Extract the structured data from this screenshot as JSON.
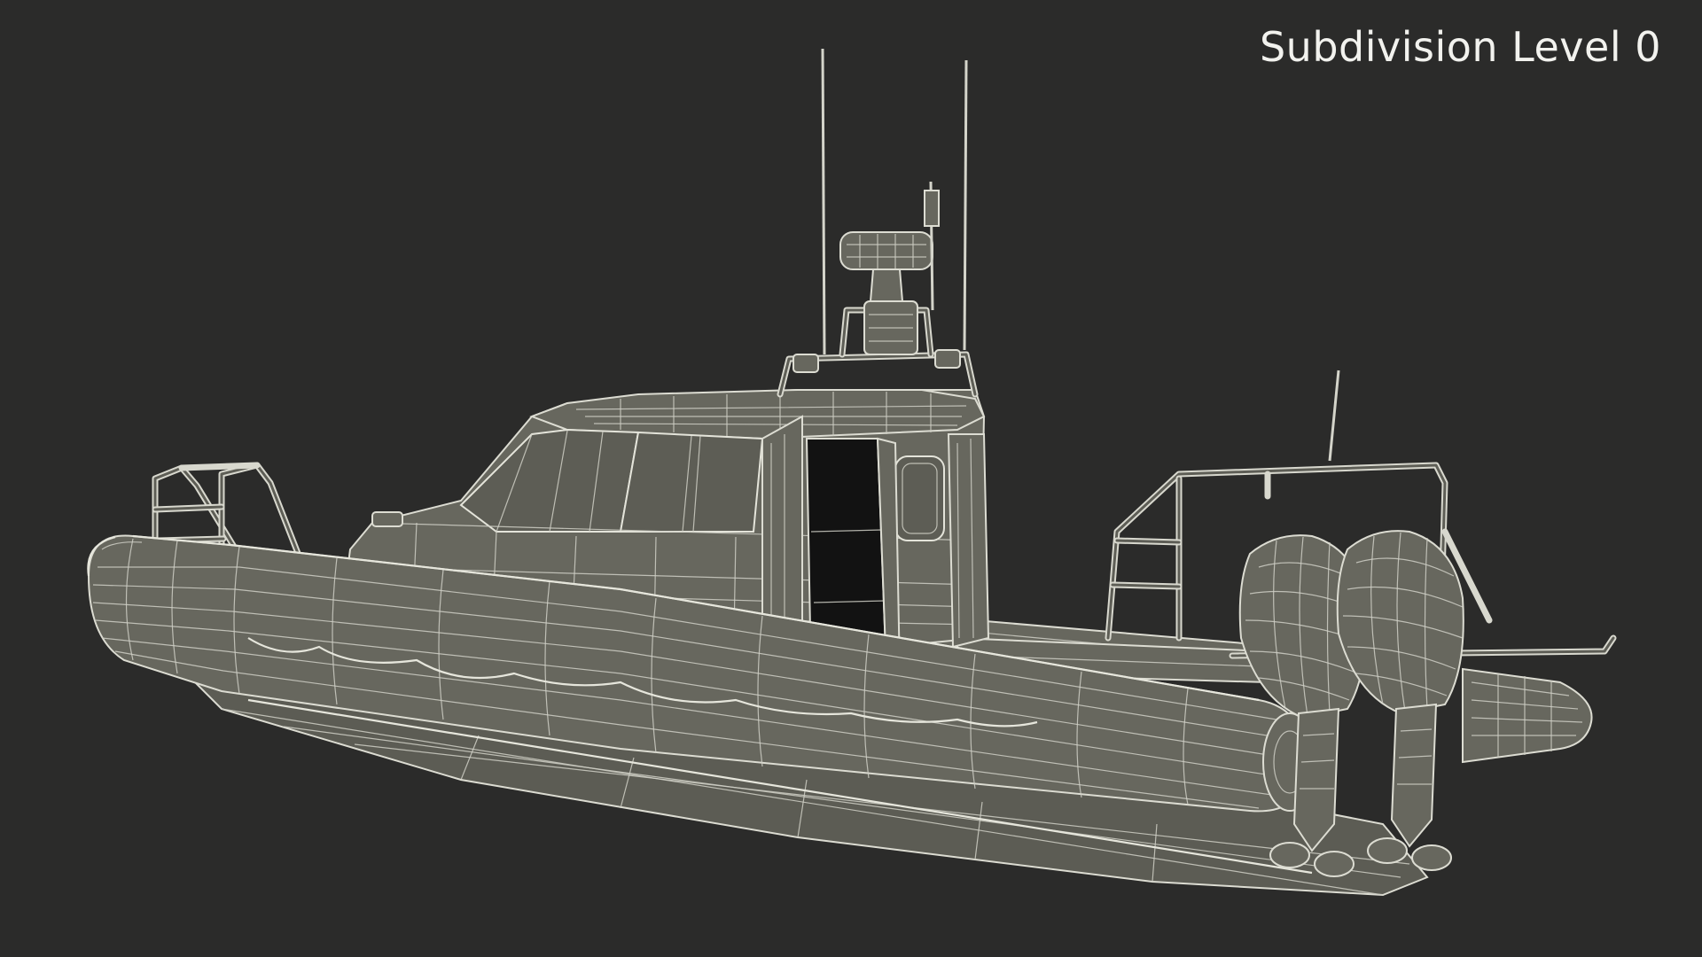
{
  "viewport": {
    "label": "Subdivision Level 0",
    "background_color": "#2b2b2a",
    "label_color": "#f2f2ee"
  },
  "model": {
    "subject": "rigid inflatable patrol boat",
    "render_style": "wireframe",
    "mesh_color": "#67675e",
    "wire_color": "#dcdcd2"
  }
}
